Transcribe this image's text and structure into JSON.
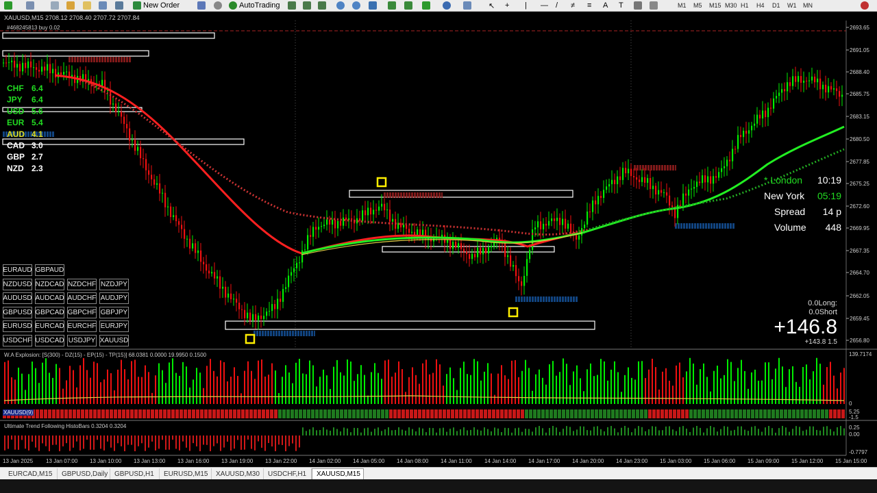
{
  "toolbar": {
    "new_order": "New Order",
    "autotrading": "AutoTrading",
    "timeframes": [
      "M1",
      "M5",
      "M15",
      "M30",
      "H1",
      "H4",
      "D1",
      "W1",
      "MN"
    ]
  },
  "chart": {
    "info": "XAUUSD,M15  2708.12 2708.40 2707.72 2707.84",
    "sub_info": "#468245813 buy 0.02",
    "price_ticks": [
      "2693.65",
      "2691.05",
      "2688.40",
      "2685.75",
      "2683.15",
      "2680.50",
      "2677.85",
      "2675.25",
      "2672.60",
      "2669.95",
      "2667.35",
      "2664.70",
      "2662.05",
      "2659.45",
      "2656.80"
    ],
    "time_ticks": [
      "13 Jan 2025",
      "13 Jan 07:00",
      "13 Jan 10:00",
      "13 Jan 13:00",
      "13 Jan 16:00",
      "13 Jan 19:00",
      "13 Jan 22:00",
      "14 Jan 02:00",
      "14 Jan 05:00",
      "14 Jan 08:00",
      "14 Jan 11:00",
      "14 Jan 14:00",
      "14 Jan 17:00",
      "14 Jan 20:00",
      "14 Jan 23:00",
      "15 Jan 03:00",
      "15 Jan 06:00",
      "15 Jan 09:00",
      "15 Jan 12:00",
      "15 Jan 15:00"
    ],
    "currency_strength": [
      {
        "name": "CHF",
        "value": "6.4",
        "color": "#22dd22"
      },
      {
        "name": "JPY",
        "value": "6.4",
        "color": "#22dd22"
      },
      {
        "name": "USD",
        "value": "5.6",
        "color": "#22dd22"
      },
      {
        "name": "EUR",
        "value": "5.4",
        "color": "#22dd22"
      },
      {
        "name": "AUD",
        "value": "4.1",
        "color": "#dddd22"
      },
      {
        "name": "CAD",
        "value": "3.0",
        "color": "#ffffff"
      },
      {
        "name": "GBP",
        "value": "2.7",
        "color": "#ffffff"
      },
      {
        "name": "NZD",
        "value": "2.3",
        "color": "#ffffff"
      }
    ],
    "sessions": {
      "london_label": "* London",
      "london_time": "10:19",
      "newyork_label": "New York",
      "newyork_time": "05:19",
      "spread_label": "Spread",
      "spread_value": "14 p",
      "volume_label": "Volume",
      "volume_value": "448"
    },
    "pnl": {
      "long": "0.0Long:",
      "short": "0.0Short",
      "total": "+146.8",
      "sub": "+143.8 1.5"
    }
  },
  "indicators": {
    "wa_label": "W.A Explosion: [S(300) - DZ(15) - EP(15) - TP(15)] 68.0381 0.0000 19.9950 0.1500",
    "wa_max": "139.7174",
    "wa_zero": "0",
    "xau_label": "XAUUSD(9)",
    "xau_max": "5.25",
    "xau_min": "-1.5",
    "ut_label": "Ultimate Trend Following HistoBars 0.3204 0.3204",
    "ut_max": "0.25",
    "ut_zero": "0.00",
    "ut_min": "-0.7797"
  },
  "pairs": [
    [
      "EURAUD",
      "GBPAUD",
      "",
      ""
    ],
    [
      "NZDUSD",
      "NZDCAD",
      "NZDCHF",
      "NZDJPY"
    ],
    [
      "AUDUSD",
      "AUDCAD",
      "AUDCHF",
      "AUDJPY"
    ],
    [
      "GBPUSD",
      "GBPCAD",
      "GBPCHF",
      "GBPJPY"
    ],
    [
      "EURUSD",
      "EURCAD",
      "EURCHF",
      "EURJPY"
    ],
    [
      "USDCHF",
      "USDCAD",
      "USDJPY",
      "XAUUSD"
    ]
  ],
  "tabs": [
    "EURCAD,M15",
    "GBPUSD,Daily",
    "GBPUSD,H1",
    "EURUSD,M15",
    "XAUUSD,M30",
    "USDCHF,H1",
    "XAUUSD,M15"
  ],
  "active_tab": 6,
  "colors": {
    "bull": "#00ee00",
    "bear": "#ee1111",
    "ma_fast": "#ff2020",
    "ma_slow": "#cc3333",
    "ma_green": "#22ee22",
    "box": "#ffffff",
    "marker": "#ffee00",
    "demand": "#2288ff"
  }
}
